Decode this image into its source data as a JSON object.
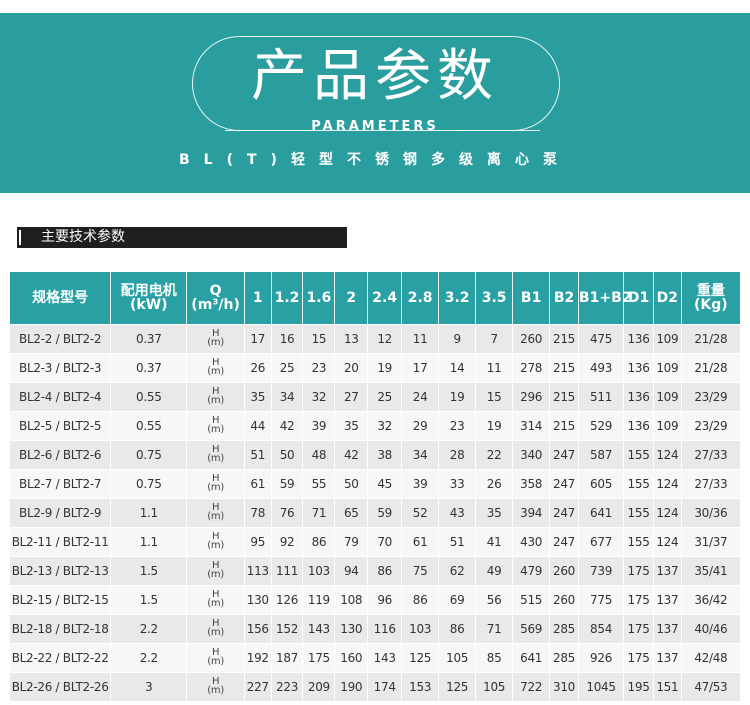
{
  "banner": {
    "title": "产品参数",
    "subtitle": "PARAMETERS",
    "product": "BL(T)轻型不锈钢多级离心泵"
  },
  "section": {
    "title": "主要技术参数"
  },
  "colors": {
    "teal": "#2a9d9e",
    "header": "#28a0a4",
    "bar": "#1f1f1f"
  },
  "table": {
    "headers": {
      "model": "规格型号",
      "motor_l1": "配用电机",
      "motor_l2": "(kW)",
      "q_l1": "Q",
      "q_l2": "(m³/h)",
      "flows": [
        "1",
        "1.2",
        "1.6",
        "2",
        "2.4",
        "2.8",
        "3.2",
        "3.5"
      ],
      "b1": "B1",
      "b2": "B2",
      "b1b2": "B1+B2",
      "d1": "D1",
      "d2": "D2",
      "weight_l1": "重量",
      "weight_l2": "(Kg)"
    },
    "hm_top": "H",
    "hm_bottom": "(m)",
    "rows": [
      {
        "model": "BL2-2 / BLT2-2",
        "kw": "0.37",
        "h": [
          "17",
          "16",
          "15",
          "13",
          "12",
          "11",
          "9",
          "7"
        ],
        "b1": "260",
        "b2": "215",
        "b1b2": "475",
        "d1": "136",
        "d2": "109",
        "wt": "21/28"
      },
      {
        "model": "BL2-3 / BLT2-3",
        "kw": "0.37",
        "h": [
          "26",
          "25",
          "23",
          "20",
          "19",
          "17",
          "14",
          "11"
        ],
        "b1": "278",
        "b2": "215",
        "b1b2": "493",
        "d1": "136",
        "d2": "109",
        "wt": "21/28"
      },
      {
        "model": "BL2-4 / BLT2-4",
        "kw": "0.55",
        "h": [
          "35",
          "34",
          "32",
          "27",
          "25",
          "24",
          "19",
          "15"
        ],
        "b1": "296",
        "b2": "215",
        "b1b2": "511",
        "d1": "136",
        "d2": "109",
        "wt": "23/29"
      },
      {
        "model": "BL2-5 / BLT2-5",
        "kw": "0.55",
        "h": [
          "44",
          "42",
          "39",
          "35",
          "32",
          "29",
          "23",
          "19"
        ],
        "b1": "314",
        "b2": "215",
        "b1b2": "529",
        "d1": "136",
        "d2": "109",
        "wt": "23/29"
      },
      {
        "model": "BL2-6 / BLT2-6",
        "kw": "0.75",
        "h": [
          "51",
          "50",
          "48",
          "42",
          "38",
          "34",
          "28",
          "22"
        ],
        "b1": "340",
        "b2": "247",
        "b1b2": "587",
        "d1": "155",
        "d2": "124",
        "wt": "27/33"
      },
      {
        "model": "BL2-7 / BLT2-7",
        "kw": "0.75",
        "h": [
          "61",
          "59",
          "55",
          "50",
          "45",
          "39",
          "33",
          "26"
        ],
        "b1": "358",
        "b2": "247",
        "b1b2": "605",
        "d1": "155",
        "d2": "124",
        "wt": "27/33"
      },
      {
        "model": "BL2-9 / BLT2-9",
        "kw": "1.1",
        "h": [
          "78",
          "76",
          "71",
          "65",
          "59",
          "52",
          "43",
          "35"
        ],
        "b1": "394",
        "b2": "247",
        "b1b2": "641",
        "d1": "155",
        "d2": "124",
        "wt": "30/36"
      },
      {
        "model": "BL2-11 / BLT2-11",
        "kw": "1.1",
        "h": [
          "95",
          "92",
          "86",
          "79",
          "70",
          "61",
          "51",
          "41"
        ],
        "b1": "430",
        "b2": "247",
        "b1b2": "677",
        "d1": "155",
        "d2": "124",
        "wt": "31/37"
      },
      {
        "model": "BL2-13 / BLT2-13",
        "kw": "1.5",
        "h": [
          "113",
          "111",
          "103",
          "94",
          "86",
          "75",
          "62",
          "49"
        ],
        "b1": "479",
        "b2": "260",
        "b1b2": "739",
        "d1": "175",
        "d2": "137",
        "wt": "35/41"
      },
      {
        "model": "BL2-15 / BLT2-15",
        "kw": "1.5",
        "h": [
          "130",
          "126",
          "119",
          "108",
          "96",
          "86",
          "69",
          "56"
        ],
        "b1": "515",
        "b2": "260",
        "b1b2": "775",
        "d1": "175",
        "d2": "137",
        "wt": "36/42"
      },
      {
        "model": "BL2-18 / BLT2-18",
        "kw": "2.2",
        "h": [
          "156",
          "152",
          "143",
          "130",
          "116",
          "103",
          "86",
          "71"
        ],
        "b1": "569",
        "b2": "285",
        "b1b2": "854",
        "d1": "175",
        "d2": "137",
        "wt": "40/46"
      },
      {
        "model": "BL2-22 / BLT2-22",
        "kw": "2.2",
        "h": [
          "192",
          "187",
          "175",
          "160",
          "143",
          "125",
          "105",
          "85"
        ],
        "b1": "641",
        "b2": "285",
        "b1b2": "926",
        "d1": "175",
        "d2": "137",
        "wt": "42/48"
      },
      {
        "model": "BL2-26 / BLT2-26",
        "kw": "3",
        "h": [
          "227",
          "223",
          "209",
          "190",
          "174",
          "153",
          "125",
          "105"
        ],
        "b1": "722",
        "b2": "310",
        "b1b2": "1045",
        "d1": "195",
        "d2": "151",
        "wt": "47/53"
      }
    ]
  }
}
